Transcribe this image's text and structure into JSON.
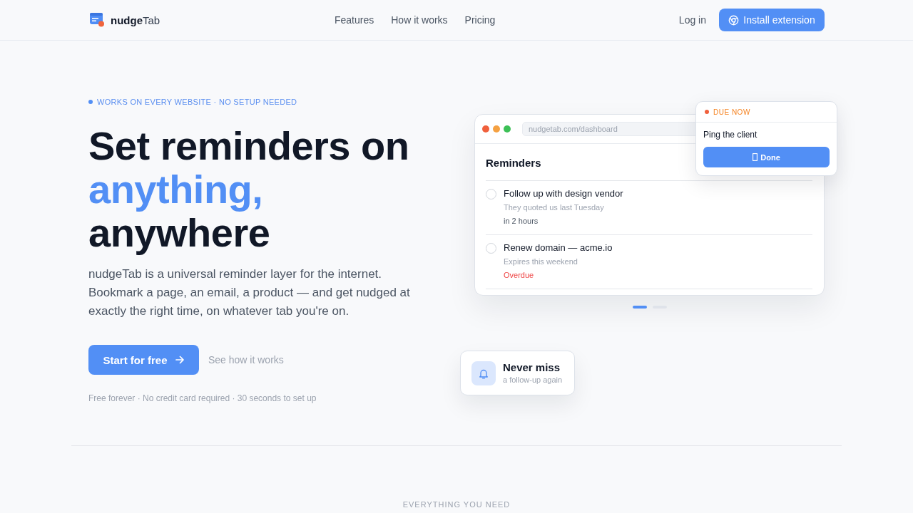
{
  "header": {
    "logo": "**nudge**Tab",
    "nav": [
      "Features",
      "How it works",
      "Pricing"
    ],
    "login": "Log in",
    "install_button": "Install extension"
  },
  "hero": {
    "eyebrow": "WORKS ON EVERY WEBSITE · NO SETUP NEEDED",
    "headline": [
      {
        "text": "Set reminders on",
        "accent": false
      },
      {
        "text": "anything,",
        "accent": true
      },
      {
        "text": "anywhere",
        "accent": false
      }
    ],
    "description": "nudgeTab is a universal reminder layer for the internet. Bookmark a page, an email, a product — and get nudged at exactly the right time, on whatever tab you're on.",
    "primary_button": "Start for free",
    "secondary_link": "See how it works",
    "fine_print": "Free forever · No credit card required · 30 seconds to set up"
  },
  "mockup": {
    "url": "nudgetab.com/dashboard",
    "title": "Reminders",
    "reminders": [
      {
        "title": "Follow up with design vendor",
        "note": "They quoted us last Tuesday",
        "due": "in 2 hours",
        "overdue": false,
        "checked": false
      },
      {
        "title": "Renew domain — acme.io",
        "note": "Expires this weekend",
        "due": "Overdue",
        "overdue": true,
        "checked": false
      }
    ],
    "slides": [
      {
        "selected": true
      },
      {
        "selected": false
      }
    ]
  },
  "popup": {
    "label": "DUE NOW",
    "text": "Ping the client",
    "button": "Done"
  },
  "callout": {
    "title": "Never miss",
    "subtitle": "a follow-up again"
  },
  "next_section": {
    "eyebrow": "EVERYTHING YOU NEED"
  }
}
